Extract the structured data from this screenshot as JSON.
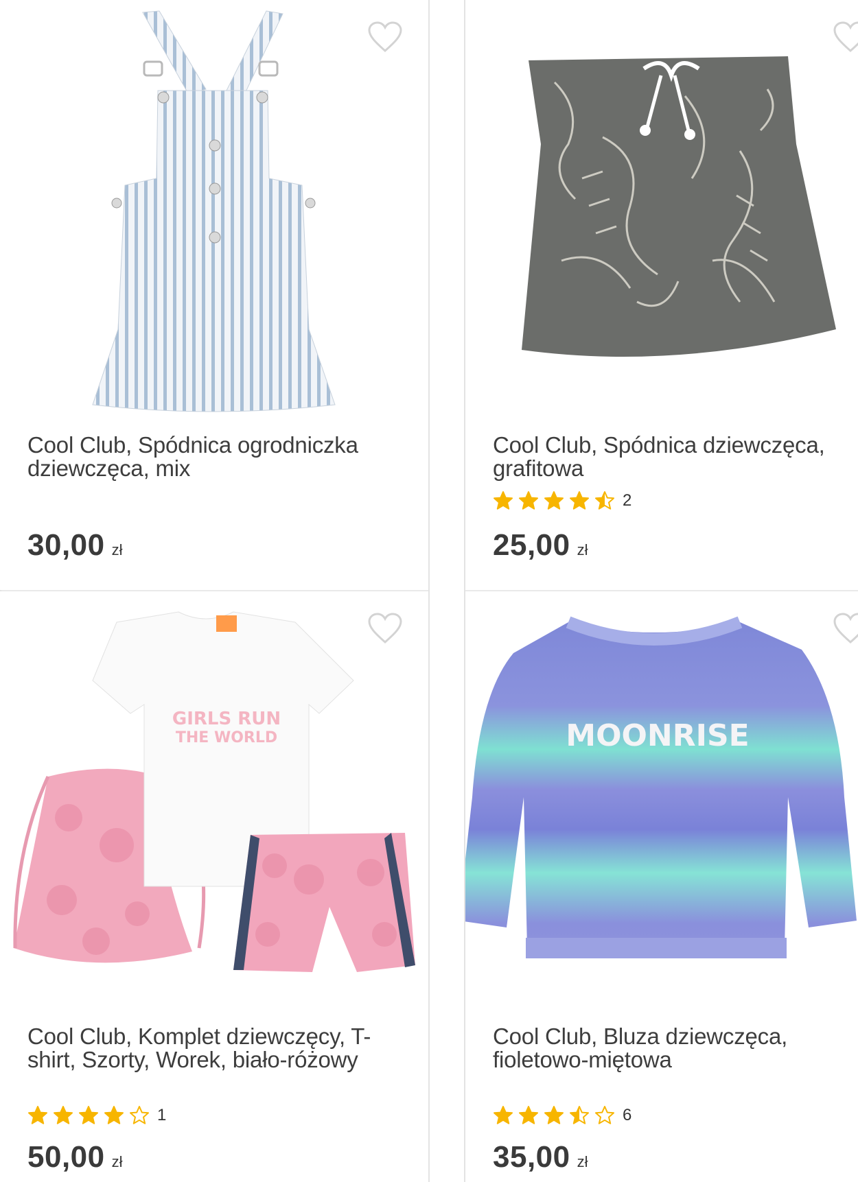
{
  "products": [
    {
      "title": "Cool Club, Spódnica ogrodniczka dziewczęca, mix",
      "price": "30,00",
      "currency": "zł",
      "rating_count": "",
      "stars": null
    },
    {
      "title": "Cool Club, Spódnica dziewczęca, grafitowa",
      "price": "25,00",
      "currency": "zł",
      "rating_count": "2",
      "stars": 4.5
    },
    {
      "title": "Cool Club, Komplet dziewczęcy, T-shirt, Szorty, Worek, biało-różowy",
      "price": "50,00",
      "currency": "zł",
      "rating_count": "1",
      "stars": 4
    },
    {
      "title": "Cool Club, Bluza dziewczęca, fioletowo-miętowa",
      "price": "35,00",
      "currency": "zł",
      "rating_count": "6",
      "stars": 3.5
    }
  ],
  "images": {
    "c1": "striped overall dress",
    "c2": "graphite floral skirt",
    "c3_print": "GIRLS RUN THE WORLD",
    "c4_print": "MOONRISE"
  },
  "colors": {
    "star": "#f7b500",
    "star_empty_stroke": "#f7b500",
    "heart_stroke": "#d3d3d3",
    "text": "#3a3a3a"
  }
}
